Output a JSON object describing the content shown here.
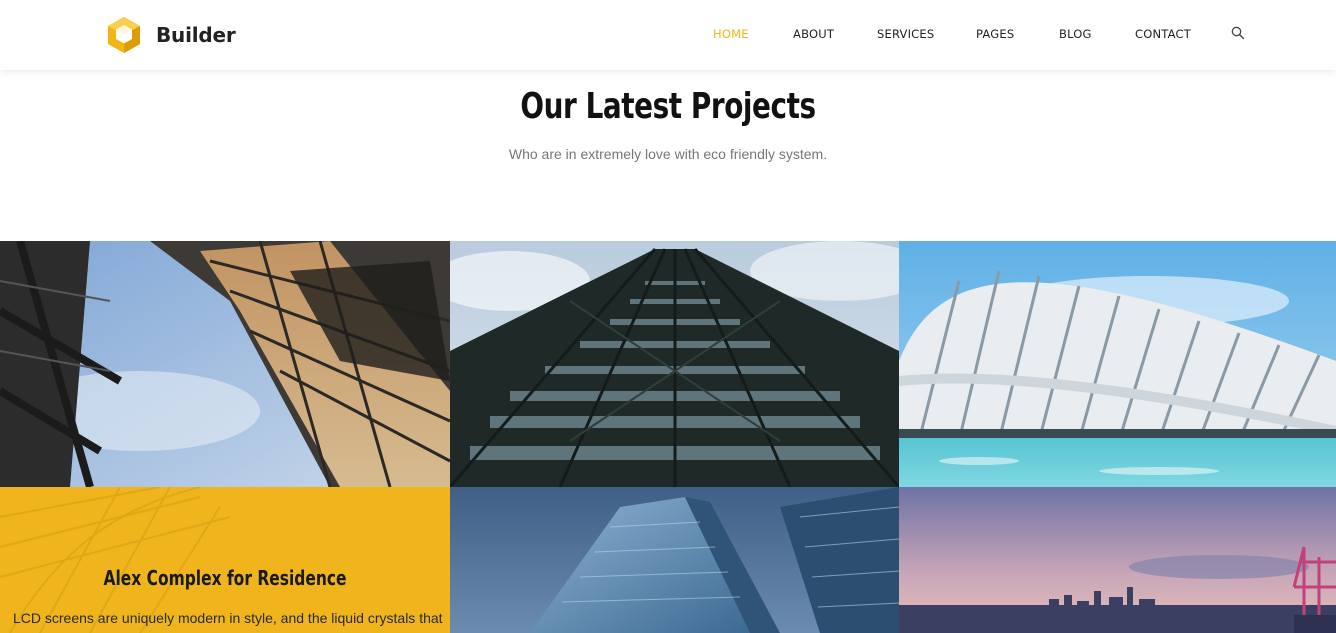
{
  "header": {
    "brand": "Builder",
    "nav": [
      {
        "label": "HOME",
        "active": true
      },
      {
        "label": "ABOUT",
        "active": false
      },
      {
        "label": "SERVICES",
        "active": false
      },
      {
        "label": "PAGES",
        "active": false
      },
      {
        "label": "BLOG",
        "active": false
      },
      {
        "label": "CONTACT",
        "active": false
      }
    ],
    "search_icon": "search-icon"
  },
  "section": {
    "title": "Our Latest Projects",
    "subtitle": "Who are in extremely love with eco friendly system."
  },
  "projects": {
    "featured": {
      "title": "Alex Complex for Residence",
      "text": "LCD screens are uniquely modern in style, and the liquid crystals that"
    }
  },
  "colors": {
    "accent": "#f1b514",
    "feature_bg": "#f0b51c",
    "text_dark": "#222222",
    "text_muted": "#777777"
  }
}
